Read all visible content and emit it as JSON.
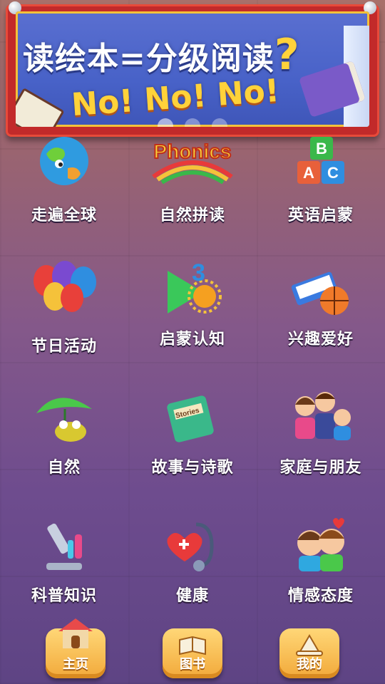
{
  "banner": {
    "title": "读绘本=分级阅读",
    "question_mark": "?",
    "subtitle": "No! No! No!",
    "slides": 3,
    "active_slide": 1
  },
  "categories": [
    {
      "label": "走遍全球",
      "icon": "globe-icon"
    },
    {
      "label": "自然拼读",
      "icon": "phonics-rainbow-icon"
    },
    {
      "label": "英语启蒙",
      "icon": "abc-blocks-icon"
    },
    {
      "label": "节日活动",
      "icon": "balloons-icon"
    },
    {
      "label": "启蒙认知",
      "icon": "number-sun-icon"
    },
    {
      "label": "兴趣爱好",
      "icon": "piano-ball-icon"
    },
    {
      "label": "自然",
      "icon": "frog-leaf-icon"
    },
    {
      "label": "故事与诗歌",
      "icon": "storybook-icon"
    },
    {
      "label": "家庭与朋友",
      "icon": "family-icon"
    },
    {
      "label": "科普知识",
      "icon": "microscope-icon"
    },
    {
      "label": "健康",
      "icon": "heart-stethoscope-icon"
    },
    {
      "label": "情感态度",
      "icon": "kids-emotion-icon"
    }
  ],
  "phonics_text": "Phonics",
  "stories_text": "Stories",
  "abc": [
    "A",
    "B",
    "C"
  ],
  "nav": [
    {
      "label": "主页",
      "icon": "house-icon",
      "active": true
    },
    {
      "label": "图书",
      "icon": "book-icon",
      "active": false
    },
    {
      "label": "我的",
      "icon": "wizard-hat-icon",
      "active": false
    }
  ]
}
